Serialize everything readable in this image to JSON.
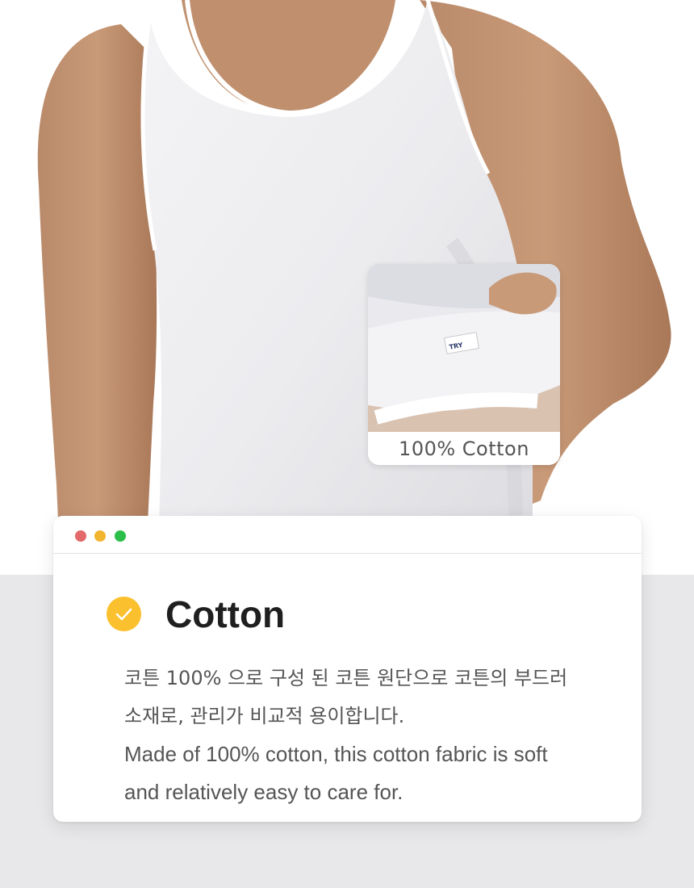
{
  "inset": {
    "caption": "100% Cotton",
    "tag_text": "TRY"
  },
  "card": {
    "window_dots": [
      "red-dot",
      "yellow-dot",
      "green-dot"
    ],
    "title": "Cotton",
    "body_lines": [
      " 코튼 100% 으로 구성 된 코튼 원단으로 코튼의 부드러",
      "소재로, 관리가 비교적 용이합니다.",
      "Made of 100% cotton, this cotton fabric is soft",
      "and relatively easy to care for."
    ]
  },
  "colors": {
    "accent_yellow": "#fbc02d",
    "dot_red": "#e26a6a",
    "dot_yellow": "#f2b530",
    "dot_green": "#2bbf4a",
    "band_grey": "#e8e8ea"
  }
}
